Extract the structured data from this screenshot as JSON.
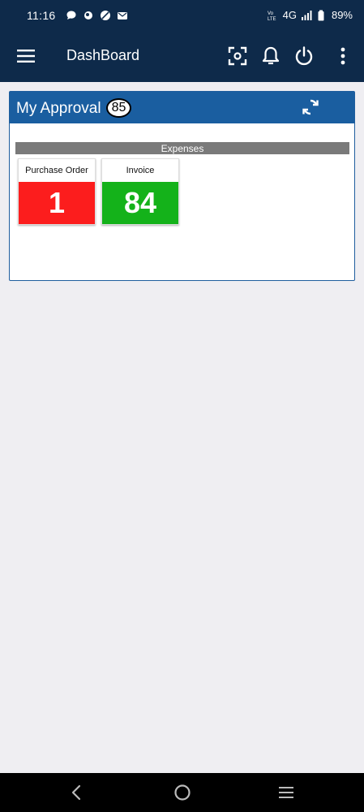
{
  "status_bar": {
    "time": "11:16",
    "network": "4G",
    "battery": "89%"
  },
  "app_bar": {
    "title": "DashBoard"
  },
  "approval": {
    "title": "My Approval",
    "count": "85",
    "section": "Expenses",
    "tiles": [
      {
        "label": "Purchase Order",
        "value": "1",
        "color": "#fc1d1d"
      },
      {
        "label": "Invoice",
        "value": "84",
        "color": "#14b21a"
      }
    ]
  },
  "colors": {
    "header": "#0e2a4a",
    "card_header": "#1a5ea0",
    "background": "#efeef2"
  }
}
